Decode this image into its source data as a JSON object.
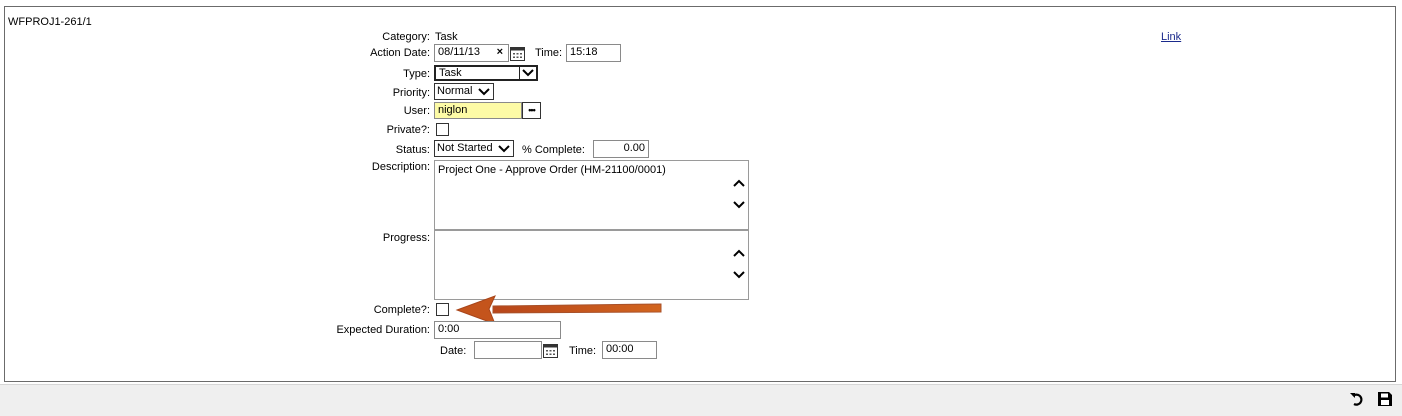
{
  "record_id": "WFPROJ1-261/1",
  "link_label": "Link",
  "form": {
    "category_label": "Category:",
    "category_value": "Task",
    "action_date_label": "Action Date:",
    "action_date_value": "08/11/13",
    "clear_glyph": "×",
    "time_label": "Time:",
    "time_value": "15:18",
    "type_label": "Type:",
    "type_value": "Task",
    "priority_label": "Priority:",
    "priority_value": "Normal",
    "user_label": "User:",
    "user_value": "niglon",
    "user_lookup_glyph": "•••",
    "private_label": "Private?:",
    "status_label": "Status:",
    "status_value": "Not Started",
    "pct_complete_label": "% Complete:",
    "pct_complete_value": "0.00",
    "description_label": "Description:",
    "description_value": "Project One - Approve Order (HM-21100/0001)",
    "progress_label": "Progress:",
    "progress_value": "",
    "complete_label": "Complete?:",
    "expected_duration_label": "Expected Duration:",
    "expected_duration_value": "0:00",
    "date_label": "Date:",
    "date_value": "",
    "time2_label": "Time:",
    "time2_value": "00:00"
  },
  "colors": {
    "required_field": "#fdfba6",
    "arrow": "#c4541c",
    "link": "#1a2a8c"
  },
  "icons": {
    "calendar": "calendar-icon",
    "undo": "undo-icon",
    "save": "save-icon"
  }
}
